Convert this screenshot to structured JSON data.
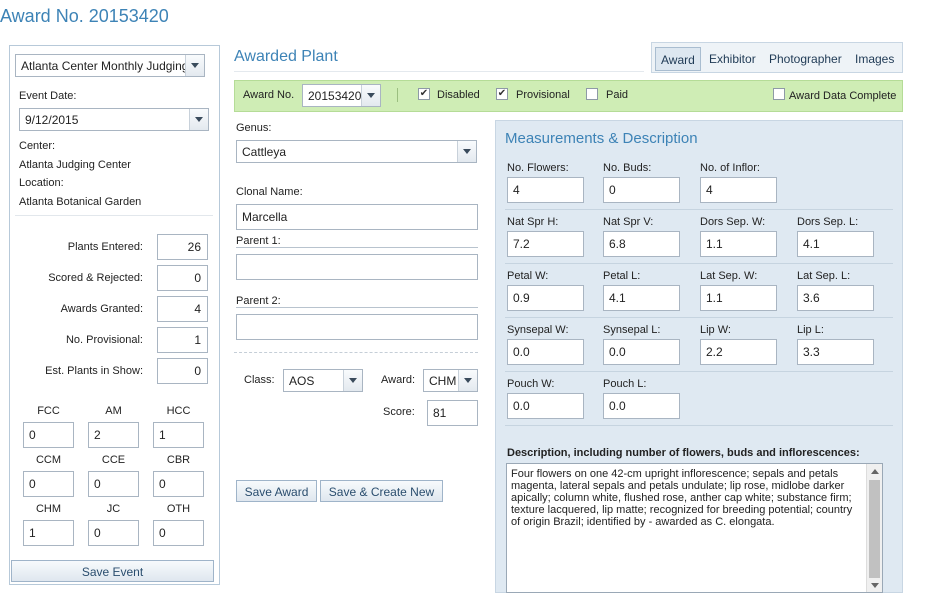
{
  "page_title": "Award No. 20153420",
  "event": {
    "event_select": "Atlanta Center Monthly Judging",
    "date_label": "Event Date:",
    "date_value": "9/12/2015",
    "center_label": "Center:",
    "center_value": "Atlanta Judging Center",
    "location_label": "Location:",
    "location_value": "Atlanta Botanical Garden",
    "stats": [
      {
        "label": "Plants Entered:",
        "value": "26"
      },
      {
        "label": "Scored & Rejected:",
        "value": "0"
      },
      {
        "label": "Awards Granted:",
        "value": "4"
      },
      {
        "label": "No. Provisional:",
        "value": "1"
      },
      {
        "label": "Est. Plants in Show:",
        "value": "0"
      }
    ],
    "award_counts": [
      {
        "label": "FCC",
        "value": "0"
      },
      {
        "label": "AM",
        "value": "2"
      },
      {
        "label": "HCC",
        "value": "1"
      },
      {
        "label": "CCM",
        "value": "0"
      },
      {
        "label": "CCE",
        "value": "0"
      },
      {
        "label": "CBR",
        "value": "0"
      },
      {
        "label": "CHM",
        "value": "1"
      },
      {
        "label": "JC",
        "value": "0"
      },
      {
        "label": "OTH",
        "value": "0"
      }
    ],
    "save_event": "Save Event"
  },
  "awarded_plant": {
    "title": "Awarded Plant",
    "tabs": [
      "Award",
      "Exhibitor",
      "Photographer",
      "Images"
    ],
    "award_no_label": "Award No.",
    "award_no_value": "20153420",
    "disabled_label": "Disabled",
    "disabled_checked": true,
    "provisional_label": "Provisional",
    "provisional_checked": true,
    "paid_label": "Paid",
    "paid_checked": false,
    "complete_label": "Award Data Complete",
    "complete_checked": false,
    "genus_label": "Genus:",
    "genus_value": "Cattleya",
    "clonal_label": "Clonal Name:",
    "clonal_value": "Marcella",
    "parent1_label": "Parent 1:",
    "parent1_value": "",
    "parent2_label": "Parent 2:",
    "parent2_value": "",
    "class_label": "Class:",
    "class_value": "AOS",
    "award_label": "Award:",
    "award_value": "CHM",
    "score_label": "Score:",
    "score_value": "81",
    "save_award": "Save Award",
    "save_create": "Save & Create New"
  },
  "measurements": {
    "title": "Measurements & Description",
    "rows": [
      [
        {
          "label": "No. Flowers:",
          "value": "4"
        },
        {
          "label": "No. Buds:",
          "value": "0"
        },
        {
          "label": "No. of Inflor:",
          "value": "4"
        }
      ],
      [
        {
          "label": "Nat Spr H:",
          "value": "7.2"
        },
        {
          "label": "Nat Spr V:",
          "value": "6.8"
        },
        {
          "label": "Dors Sep. W:",
          "value": "1.1"
        },
        {
          "label": "Dors Sep. L:",
          "value": "4.1"
        }
      ],
      [
        {
          "label": "Petal W:",
          "value": "0.9"
        },
        {
          "label": "Petal L:",
          "value": "4.1"
        },
        {
          "label": "Lat Sep. W:",
          "value": "1.1"
        },
        {
          "label": "Lat Sep. L:",
          "value": "3.6"
        }
      ],
      [
        {
          "label": "Synsepal W:",
          "value": "0.0"
        },
        {
          "label": "Synsepal L:",
          "value": "0.0"
        },
        {
          "label": "Lip W:",
          "value": "2.2"
        },
        {
          "label": "Lip L:",
          "value": "3.3"
        }
      ],
      [
        {
          "label": "Pouch W:",
          "value": "0.0"
        },
        {
          "label": "Pouch L:",
          "value": "0.0"
        }
      ]
    ],
    "desc_label": "Description, including number of flowers, buds and inflorescences:",
    "desc_value": "Four flowers on one 42-cm upright inflorescence; sepals and petals magenta, lateral sepals and petals undulate; lip rose, midlobe darker apically; column white, flushed rose, anther cap white; substance firm; texture lacquered, lip matte; recognized for breeding potential; country of origin Brazil; identified by - awarded as C. elongata."
  }
}
